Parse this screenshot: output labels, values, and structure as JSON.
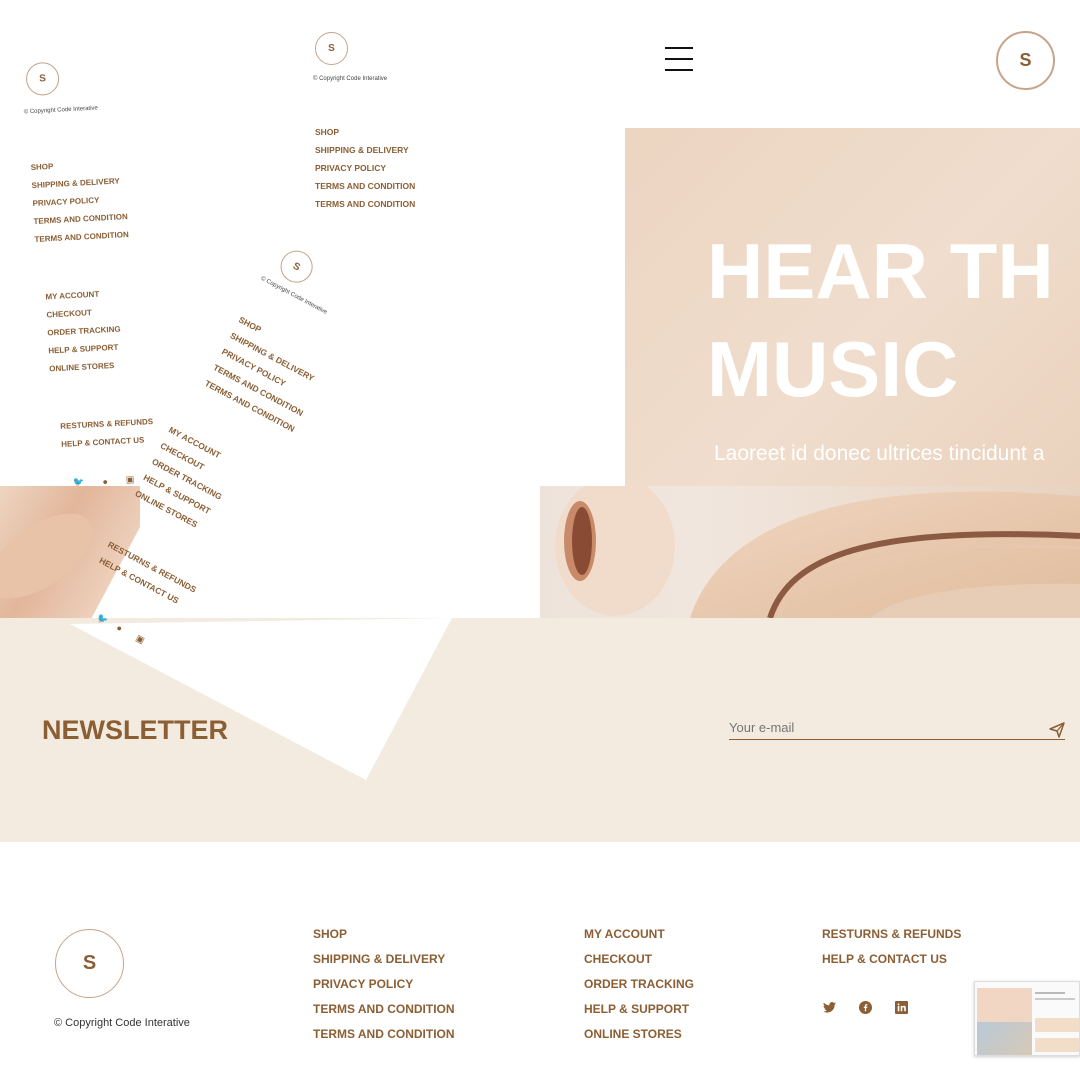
{
  "header": {
    "logo_letter": "S",
    "menu_icon": "hamburger-menu-icon"
  },
  "hero": {
    "title": "HEAR TH\nMUSIC",
    "subtitle": "Laoreet id donec ultrices tincidunt a",
    "image_icon": "headphones-image"
  },
  "newsletter": {
    "heading": "NEWSLETTER",
    "email_placeholder": "Your e-mail",
    "submit_icon": "paper-plane-icon"
  },
  "footer": {
    "logo_letter": "S",
    "copyright": "© Copyright Code Interative",
    "col1": [
      "SHOP",
      "SHIPPING & DELIVERY",
      "PRIVACY POLICY",
      "TERMS AND CONDITION",
      "TERMS AND CONDITION"
    ],
    "col2": [
      "MY ACCOUNT",
      "CHECKOUT",
      "ORDER TRACKING",
      "HELP & SUPPORT",
      "ONLINE STORES"
    ],
    "col3": [
      "RESTURNS & REFUNDS",
      "HELP & CONTACT US"
    ],
    "social": [
      "twitter-icon",
      "facebook-icon",
      "linkedin-icon"
    ]
  },
  "colors": {
    "brand_brown": "#8b5e34",
    "hero_peach": "#ecd5c1",
    "newsletter_bg": "#f3ebe0"
  }
}
